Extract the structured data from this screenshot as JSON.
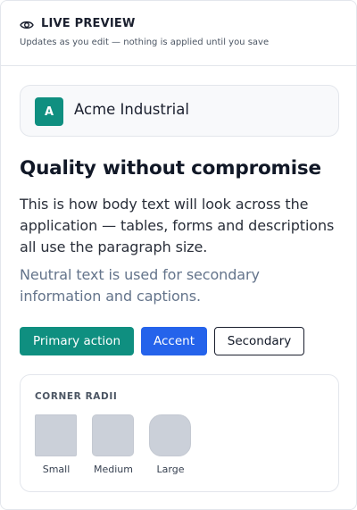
{
  "header": {
    "title": "LIVE PREVIEW",
    "subtitle": "Updates as you edit — nothing is applied until you save",
    "icon": "eye-icon"
  },
  "brand": {
    "initial": "A",
    "name": "Acme Industrial",
    "color": "#0f8f80"
  },
  "content": {
    "heading": "Quality without compromise",
    "body": "This is how body text will look across the application — tables, forms and descriptions all use the paragraph size.",
    "neutral": "Neutral text is used for secondary information and captions."
  },
  "buttons": {
    "primary": "Primary action",
    "accent": "Accent",
    "secondary": "Secondary"
  },
  "colors": {
    "primary": "#0f8f80",
    "accent": "#2563eb",
    "neutral_text": "#64748b"
  },
  "radii": {
    "title": "CORNER RADII",
    "items": [
      {
        "label": "Small"
      },
      {
        "label": "Medium"
      },
      {
        "label": "Large"
      }
    ]
  }
}
